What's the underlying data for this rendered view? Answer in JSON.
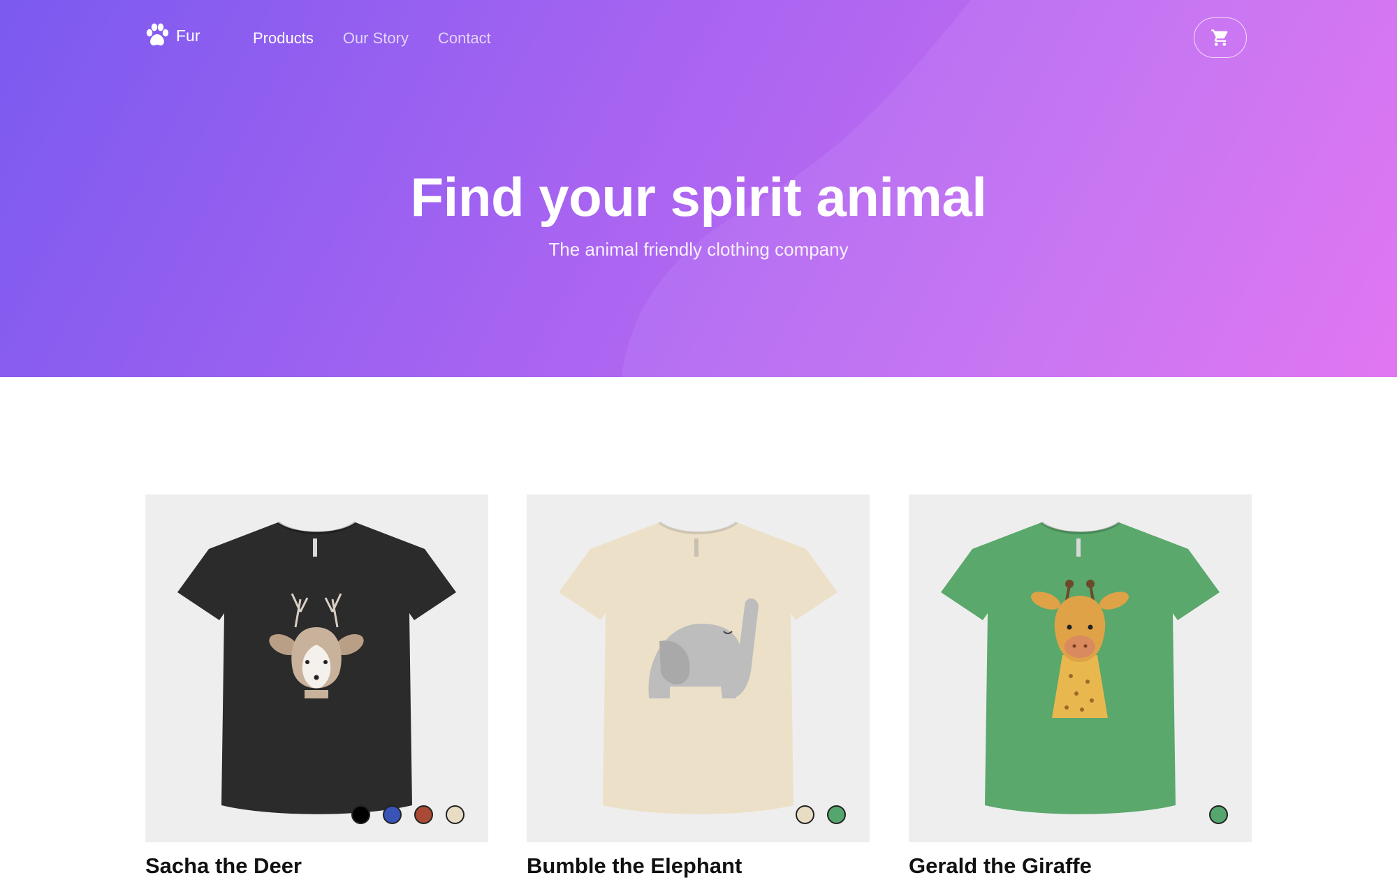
{
  "brand": {
    "name": "Fur",
    "logo_icon": "paw-icon"
  },
  "nav": {
    "items": [
      {
        "label": "Products",
        "active": true
      },
      {
        "label": "Our Story",
        "active": false
      },
      {
        "label": "Contact",
        "active": false
      }
    ],
    "cart_icon": "cart-icon"
  },
  "hero": {
    "title": "Find your spirit animal",
    "subtitle": "The animal friendly clothing company",
    "gradient_start": "#7b5af0",
    "gradient_end": "#df6cf2"
  },
  "products": [
    {
      "name": "Sacha the Deer",
      "shirt_color": "#2b2b2b",
      "illustration": "deer-illustration",
      "swatches": [
        "#000000",
        "#3754b6",
        "#a84a35",
        "#e8dcc3"
      ]
    },
    {
      "name": "Bumble the Elephant",
      "shirt_color": "#ece1c8",
      "illustration": "elephant-illustration",
      "swatches": [
        "#e8dcc3",
        "#55a66e"
      ]
    },
    {
      "name": "Gerald the Giraffe",
      "shirt_color": "#5aa86b",
      "illustration": "giraffe-illustration",
      "swatches": [
        "#55a66e"
      ]
    }
  ]
}
